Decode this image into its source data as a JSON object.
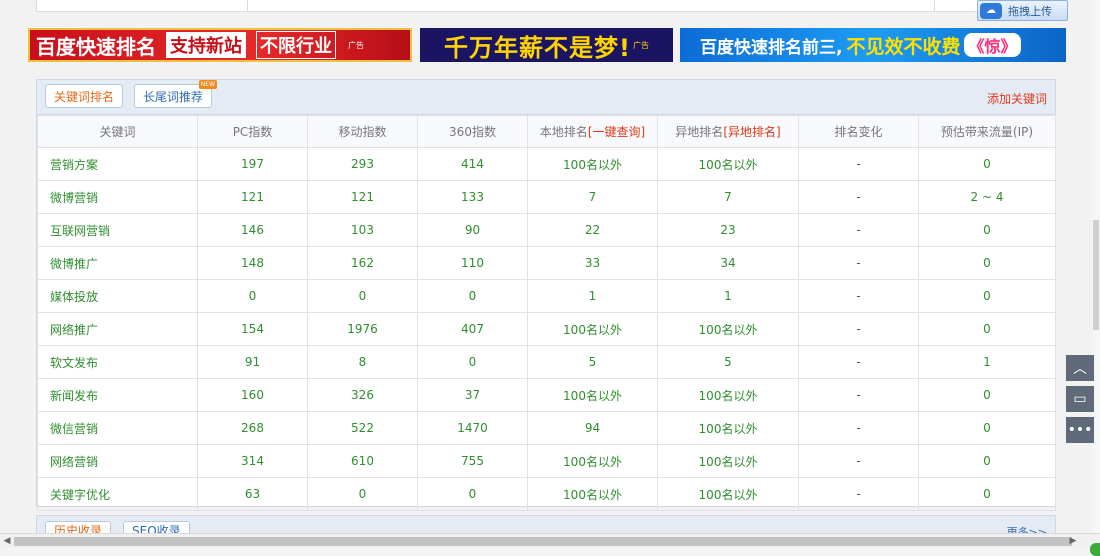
{
  "toolbar": {
    "upload_label": "拖拽上传"
  },
  "banners": [
    {
      "texts": [
        "百度快速排名",
        "支持新站",
        "不限行业"
      ],
      "ad": "广告"
    },
    {
      "texts": [
        "千万年薪不是梦!"
      ],
      "ad": "广告"
    },
    {
      "texts": [
        "百度快速排名前三,",
        "不见效不收费",
        "《惊》"
      ]
    }
  ],
  "panel": {
    "tabs": [
      {
        "label": "关键词排名"
      },
      {
        "label": "长尾词推荐",
        "badge": "NEW"
      }
    ],
    "add_link": "添加关键词",
    "table": {
      "headers": {
        "keyword": "关键词",
        "pc": "PC指数",
        "mobile": "移动指数",
        "s360": "360指数",
        "local": "本地排名",
        "local_link": "[一键查询]",
        "remote": "异地排名",
        "remote_link": "[异地排名]",
        "change": "排名变化",
        "traffic": "预估带来流量(IP)"
      },
      "rows": [
        {
          "kw": "营销方案",
          "pc": "197",
          "mobile": "293",
          "s360": "414",
          "local": "100名以外",
          "remote": "100名以外",
          "change": "-",
          "traffic": "0"
        },
        {
          "kw": "微博营销",
          "pc": "121",
          "mobile": "121",
          "s360": "133",
          "local": "7",
          "remote": "7",
          "change": "-",
          "traffic": "2 ~ 4"
        },
        {
          "kw": "互联网营销",
          "pc": "146",
          "mobile": "103",
          "s360": "90",
          "local": "22",
          "remote": "23",
          "change": "-",
          "traffic": "0"
        },
        {
          "kw": "微博推广",
          "pc": "148",
          "mobile": "162",
          "s360": "110",
          "local": "33",
          "remote": "34",
          "change": "-",
          "traffic": "0"
        },
        {
          "kw": "媒体投放",
          "pc": "0",
          "mobile": "0",
          "s360": "0",
          "local": "1",
          "remote": "1",
          "change": "-",
          "traffic": "0"
        },
        {
          "kw": "网络推广",
          "pc": "154",
          "mobile": "1976",
          "s360": "407",
          "local": "100名以外",
          "remote": "100名以外",
          "change": "-",
          "traffic": "0"
        },
        {
          "kw": "软文发布",
          "pc": "91",
          "mobile": "8",
          "s360": "0",
          "local": "5",
          "remote": "5",
          "change": "-",
          "traffic": "1"
        },
        {
          "kw": "新闻发布",
          "pc": "160",
          "mobile": "326",
          "s360": "37",
          "local": "100名以外",
          "remote": "100名以外",
          "change": "-",
          "traffic": "0"
        },
        {
          "kw": "微信营销",
          "pc": "268",
          "mobile": "522",
          "s360": "1470",
          "local": "94",
          "remote": "100名以外",
          "change": "-",
          "traffic": "0"
        },
        {
          "kw": "网络营销",
          "pc": "314",
          "mobile": "610",
          "s360": "755",
          "local": "100名以外",
          "remote": "100名以外",
          "change": "-",
          "traffic": "0"
        },
        {
          "kw": "关键字优化",
          "pc": "63",
          "mobile": "0",
          "s360": "0",
          "local": "100名以外",
          "remote": "100名以外",
          "change": "-",
          "traffic": "0"
        }
      ]
    }
  },
  "bottom": {
    "tabs": [
      "历史收录",
      "SEO收录"
    ],
    "more": "更多>>"
  },
  "icons": {
    "upload": "cloud-icon",
    "top": "chevron-up-icon",
    "feedback": "comment-icon",
    "more": "more-dots-icon"
  }
}
